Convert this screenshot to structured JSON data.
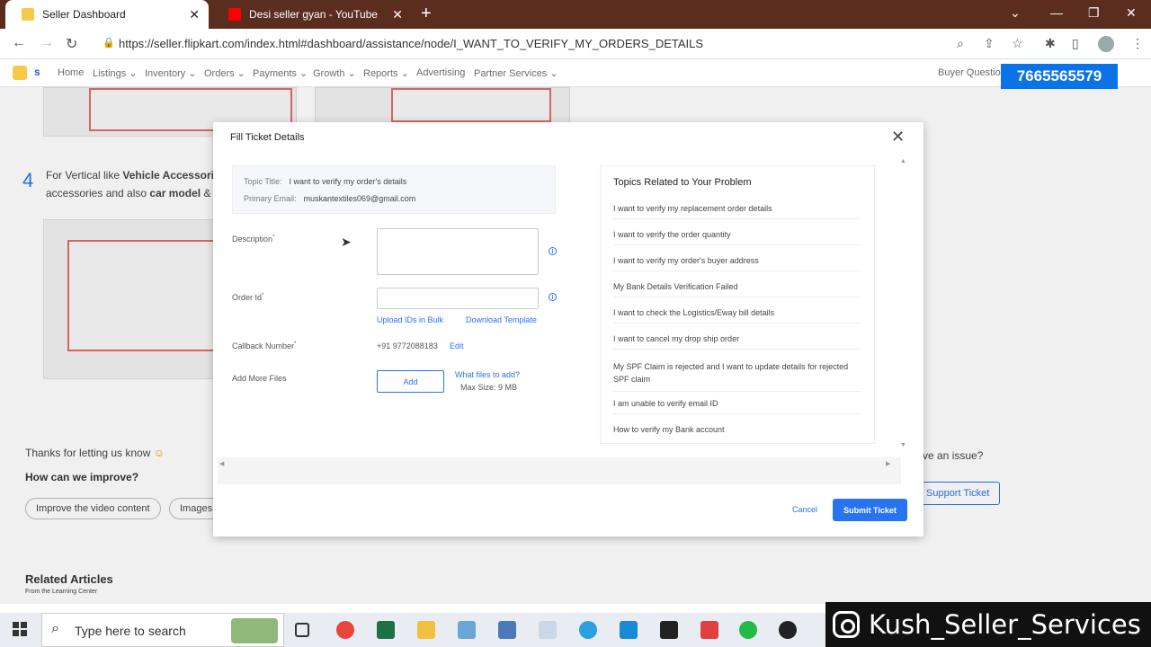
{
  "browser": {
    "tabs": [
      {
        "title": "Seller Dashboard",
        "active": true
      },
      {
        "title": "Desi seller gyan - YouTube",
        "active": false
      }
    ],
    "url": "https://seller.flipkart.com/index.html#dashboard/assistance/node/I_WANT_TO_VERIFY_MY_ORDERS_DETAILS"
  },
  "sitenav": {
    "logo_text": "s",
    "items": [
      "Home",
      "Listings",
      "Inventory",
      "Orders",
      "Payments",
      "Growth",
      "Reports",
      "Advertising",
      "Partner Services"
    ],
    "right_text": "Buyer Question",
    "phone": "7665565579"
  },
  "background": {
    "step_number": "4",
    "step_text_1a": "For Vertical  like ",
    "step_text_1b": "Vehicle Accessori",
    "step_text_2a": "accessories and also ",
    "step_text_2b": "car model",
    "step_text_2c": " & y",
    "feedback_title": "Thanks for letting us know",
    "improve_q": "How can we improve?",
    "pill_1": "Improve the video content",
    "pill_2": "Images",
    "issue_text": "ve an issue?",
    "support_ticket": "Support Ticket",
    "related_title": "Related Articles",
    "related_sub": "From the Learning Center"
  },
  "modal": {
    "title": "Fill Ticket Details",
    "topic_label": "Topic Title:",
    "topic_value": "I want to verify my order's details",
    "email_label": "Primary Email:",
    "email_value": "muskantextiles069@gmail.com",
    "description_label": "Description",
    "order_id_label": "Order Id",
    "upload_bulk": "Upload IDs in Bulk",
    "download_template": "Download Template",
    "callback_label": "Callback Number",
    "callback_value": "+91 9772088183",
    "edit": "Edit",
    "add_files_label": "Add More Files",
    "add_button": "Add",
    "what_files": "What files to add?",
    "max_size": "Max Size: 9 MB",
    "related_title": "Topics Related to Your Problem",
    "related_items": [
      "I want to verify my replacement order details",
      "I want to verify the order quantity",
      "I want to verify my order's buyer address",
      "My Bank Details Verification Failed",
      "I want to check the Logistics/Eway bill details",
      "I want to cancel my drop ship order",
      "My SPF Claim is rejected and I want to update details for rejected SPF claim",
      "I am unable to verify email ID",
      "How to verify my Bank account"
    ],
    "cancel": "Cancel",
    "submit": "Submit Ticket"
  },
  "taskbar": {
    "search_placeholder": "Type here to search"
  },
  "watermark": "Kush_Seller_Services"
}
